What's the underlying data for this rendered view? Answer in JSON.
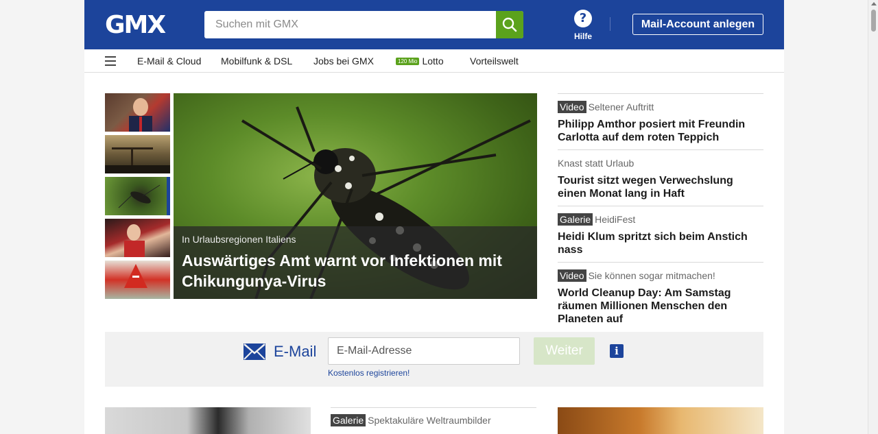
{
  "header": {
    "logo": "GMX",
    "search_placeholder": "Suchen mit GMX",
    "help_label": "Hilfe",
    "account_button": "Mail-Account anlegen"
  },
  "nav": {
    "items": [
      {
        "label": "E-Mail & Cloud"
      },
      {
        "label": "Mobilfunk & DSL"
      },
      {
        "label": "Jobs bei GMX"
      },
      {
        "label": "Lotto",
        "badge": "120 Mio"
      },
      {
        "label": "Vorteilswelt"
      }
    ]
  },
  "hero": {
    "kicker": "In Urlaubsregionen Italiens",
    "title": "Auswärtiges Amt warnt vor Infektionen mit Chikungunya-Virus"
  },
  "teasers": [
    {
      "tag": "Video",
      "kicker": "Seltener Auftritt",
      "headline": "Philipp Amthor posiert mit Freundin Carlotta auf dem roten Teppich"
    },
    {
      "tag": "",
      "kicker": "Knast statt Urlaub",
      "headline": "Tourist sitzt wegen Verwechslung einen Monat lang in Haft"
    },
    {
      "tag": "Galerie",
      "kicker": "HeidiFest",
      "headline": "Heidi Klum spritzt sich beim Anstich nass"
    },
    {
      "tag": "Video",
      "kicker": "Sie können sogar mitmachen!",
      "headline": "World Cleanup Day: Am Samstag räumen Millionen Menschen den Planeten auf"
    }
  ],
  "mail_login": {
    "label": "E-Mail",
    "input_placeholder": "E-Mail-Adresse",
    "submit": "Weiter",
    "info": "i",
    "register_link": "Kostenlos registrieren!"
  },
  "bottom": {
    "teaser_tag": "Galerie",
    "teaser_kicker": "Spektakuläre Weltraumbilder"
  },
  "colors": {
    "brand_blue": "#1c449b",
    "accent_green": "#5ba21c"
  }
}
